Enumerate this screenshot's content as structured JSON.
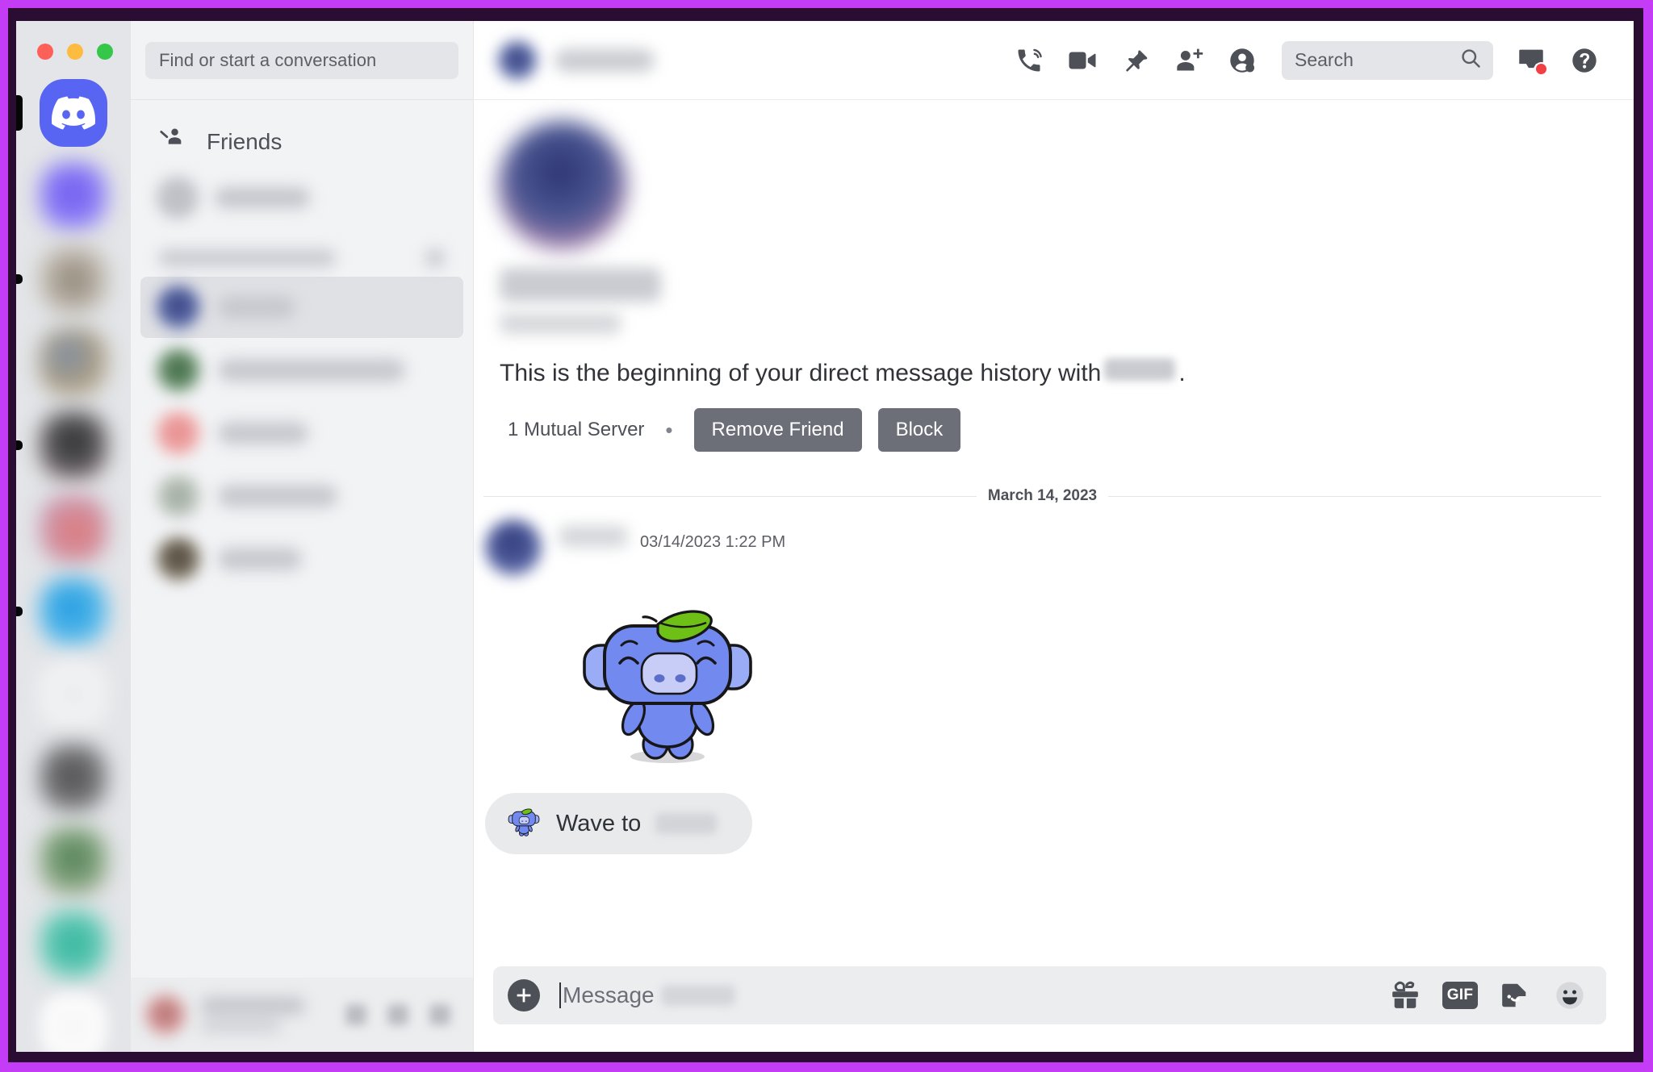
{
  "window": {
    "traffic_lights": [
      "close",
      "minimize",
      "zoom"
    ],
    "accent_frame_color": "#c43cf5"
  },
  "server_rail": {
    "home_label": "Discord",
    "items": [
      {
        "name": "server-1",
        "redacted": true
      },
      {
        "name": "server-2",
        "redacted": true
      },
      {
        "name": "server-3",
        "redacted": true
      },
      {
        "name": "server-4",
        "redacted": true
      },
      {
        "name": "server-5",
        "redacted": true
      },
      {
        "name": "server-6",
        "redacted": true
      },
      {
        "name": "server-7",
        "redacted": true
      },
      {
        "name": "server-8",
        "redacted": true
      },
      {
        "name": "server-9",
        "redacted": true
      },
      {
        "name": "server-10",
        "redacted": true
      },
      {
        "name": "server-11",
        "redacted": true
      },
      {
        "name": "add-server",
        "redacted": true
      }
    ]
  },
  "sidebar": {
    "search": {
      "placeholder": "Find or start a conversation",
      "value": ""
    },
    "friends_label": "Friends",
    "nitro_row_redacted": true,
    "section_header_redacted": true,
    "dm_items": [
      {
        "redacted": true,
        "active": true,
        "avatar_color": "#3b4a8c",
        "name_width": 96
      },
      {
        "redacted": true,
        "active": false,
        "avatar_color": "#3e6b43",
        "name_width": 232
      },
      {
        "redacted": true,
        "active": false,
        "avatar_color": "#d98a8a",
        "name_width": 112
      },
      {
        "redacted": true,
        "active": false,
        "avatar_color": "#9aa59a",
        "name_width": 148
      },
      {
        "redacted": true,
        "active": false,
        "avatar_color": "#6b6458",
        "name_width": 104
      }
    ],
    "user_panel": {
      "redacted": true,
      "controls": [
        "mic-icon",
        "headset-icon",
        "settings-icon"
      ]
    }
  },
  "topbar": {
    "dm_name_redacted": true,
    "icons": [
      {
        "name": "start-voice-call-icon",
        "label": "Start Voice Call"
      },
      {
        "name": "start-video-call-icon",
        "label": "Start Video Call"
      },
      {
        "name": "pinned-messages-icon",
        "label": "Pinned Messages"
      },
      {
        "name": "add-friends-to-dm-icon",
        "label": "Add Friends to DM"
      },
      {
        "name": "user-profile-icon",
        "label": "Show User Profile"
      }
    ],
    "search": {
      "placeholder": "Search",
      "value": ""
    },
    "inbox": {
      "name": "inbox-icon",
      "has_unread": true,
      "badge_color": "#f23f43"
    },
    "help": {
      "name": "help-icon",
      "label": "Help"
    }
  },
  "conversation": {
    "profile_redacted": true,
    "beginning_text_prefix": "This is the beginning of your direct message history with",
    "beginning_text_suffix": ".",
    "mutual_servers": "1 Mutual Server",
    "separator": "•",
    "remove_friend_label": "Remove Friend",
    "block_label": "Block",
    "date_divider": "March 14, 2023",
    "message": {
      "author_redacted": true,
      "timestamp": "03/14/2023 1:22 PM",
      "sticker_name": "wumpus-leaf-sticker"
    },
    "wave_button": {
      "label": "Wave to",
      "target_redacted": true,
      "icon": "wumpus-wave-icon"
    }
  },
  "composer": {
    "add_attachment_icon": "plus-icon",
    "placeholder": "Message",
    "target_redacted": true,
    "tools": [
      {
        "name": "gift-icon",
        "label": "Gift a Nitro subscription"
      },
      {
        "name": "gif-icon",
        "label": "GIF"
      },
      {
        "name": "sticker-icon",
        "label": "Sticker"
      },
      {
        "name": "emoji-icon",
        "label": "Emoji"
      }
    ]
  },
  "colors": {
    "brand": "#5865f2",
    "rail_bg": "#e3e5e8",
    "sidebar_bg": "#f2f3f5",
    "main_bg": "#ffffff",
    "button_gray": "#6d6f78",
    "text_primary": "#313338",
    "text_muted": "#5c5e66",
    "unread_red": "#f23f43"
  }
}
